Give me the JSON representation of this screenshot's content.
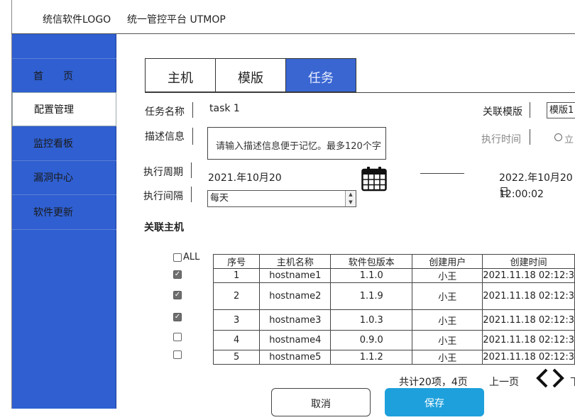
{
  "header": {
    "logo": "统信软件LOGO",
    "platform": "统一管控平台 UTMOP"
  },
  "sidebar": {
    "items": [
      {
        "label": "首　　页"
      },
      {
        "label": "配置管理"
      },
      {
        "label": "监控看板"
      },
      {
        "label": "漏洞中心"
      },
      {
        "label": "软件更新"
      }
    ],
    "active_index": 1
  },
  "tabs": [
    {
      "label": "主机"
    },
    {
      "label": "模版"
    },
    {
      "label": "任务"
    }
  ],
  "form": {
    "task_name_label": "任务名称",
    "task_name_value": "task 1",
    "template_label": "关联模版",
    "template_value": "模版1",
    "desc_label": "描述信息",
    "desc_placeholder": "请输入描述信息便于记忆。最多120个字",
    "exec_time_label": "执行时间",
    "exec_time_radio": "立",
    "period_label": "执行周期",
    "period_start": "2021.年10月20",
    "period_end": "2022.年10月20日",
    "end_time": "12:00:02",
    "interval_label": "执行间隔",
    "interval_value": "每天",
    "hosts_label": "关联主机"
  },
  "table": {
    "select_all_label": "ALL",
    "columns": [
      "序号",
      "主机名称",
      "软件包版本",
      "创建用户",
      "创建时间"
    ],
    "rows": [
      {
        "checked": true,
        "no": "1",
        "host": "hostname1",
        "version": "1.1.0",
        "user": "小王",
        "time": "2021.11.18 02:12:3"
      },
      {
        "checked": true,
        "no": "2",
        "host": "hostname2",
        "version": "1.1.9",
        "user": "小王",
        "time": "2021.11.18 02:12:3"
      },
      {
        "checked": true,
        "no": "3",
        "host": "hostname3",
        "version": "1.0.3",
        "user": "小王",
        "time": "2021.11.18 02:12:3"
      },
      {
        "checked": false,
        "no": "4",
        "host": "hostname4",
        "version": "0.9.0",
        "user": "小王",
        "time": "2021.11.18 02:12:3"
      },
      {
        "checked": false,
        "no": "5",
        "host": "hostname5",
        "version": "1.1.2",
        "user": "小王",
        "time": "2021.11.18 02:12:3"
      }
    ]
  },
  "pagination": {
    "summary": "共计20项，4页",
    "prev_label": "上一页",
    "next_label": "下"
  },
  "actions": {
    "cancel": "取消",
    "save": "保存"
  },
  "colors": {
    "brand_blue": "#2f5fd0",
    "save_blue": "#1ea0dc"
  }
}
